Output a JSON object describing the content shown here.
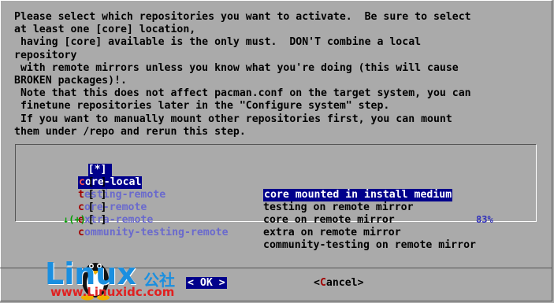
{
  "prompt": {
    "lines": [
      "Please select which repositories you want to activate.  Be sure to select",
      "at least one [core] location,",
      " having [core] available is the only must.  DON'T combine a local",
      "repository",
      " with remote mirrors unless you know what you're doing (this will cause",
      "BROKEN packages)!.",
      " Note that this does not affect pacman.conf on the target system, you can",
      " finetune repositories later in the \"Configure system\" step.",
      " If you want to manually mount other repositories first, you can mount",
      "them under /repo and rerun this step."
    ]
  },
  "menu": {
    "items": [
      {
        "check": "[*]",
        "tag_hot": "c",
        "tag_rest": "ore-local",
        "desc": "core mounted in install medium",
        "selected": true
      },
      {
        "check": "[ ]",
        "tag_hot": "t",
        "tag_rest": "esting-remote",
        "desc": "testing on remote mirror",
        "selected": false
      },
      {
        "check": "[ ]",
        "tag_hot": "c",
        "tag_rest": "ore-remote",
        "desc": "core on remote mirror",
        "selected": false
      },
      {
        "check": "[ ]",
        "tag_hot": "e",
        "tag_rest": "xtra-remote",
        "desc": "extra on remote mirror",
        "selected": false
      },
      {
        "check": "[ ]",
        "tag_hot": "c",
        "tag_rest": "ommunity-testing-remote",
        "desc": "community-testing on remote mirror",
        "selected": false
      }
    ],
    "scroll_indicator": "↓(+)",
    "scroll_percent": "83%"
  },
  "buttons": {
    "ok_left": "<",
    "ok_label": "OK",
    "ok_right": ">",
    "cancel_left": "<",
    "cancel_hot": "C",
    "cancel_rest": "ancel",
    "cancel_right": ">"
  },
  "watermark": {
    "brand": "Linux",
    "brand_cn": "公社",
    "url": "www.Linuxidc.com"
  },
  "colors": {
    "dialog_bg": "#aaaaaa",
    "selection_bg": "#00008b",
    "hotkey": "#a00000",
    "tag_text": "#6a6acd"
  }
}
